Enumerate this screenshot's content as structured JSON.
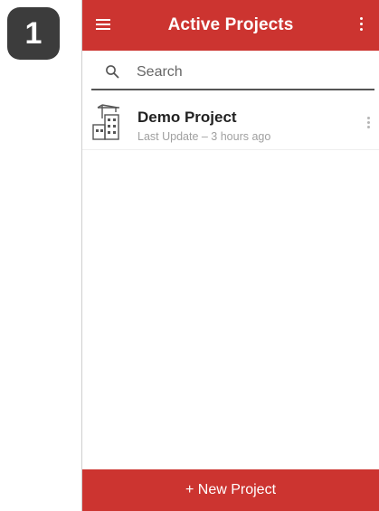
{
  "step": {
    "number": "1"
  },
  "appbar": {
    "title": "Active Projects",
    "menu_icon": "hamburger-menu-icon",
    "overflow_icon": "more-vertical-icon",
    "color": "#cc3430"
  },
  "search": {
    "placeholder": "Search",
    "value": "",
    "icon": "search-icon"
  },
  "projects": [
    {
      "name": "Demo Project",
      "subtitle": "Last Update – 3 hours ago",
      "icon": "building-crane-icon"
    }
  ],
  "footer": {
    "new_project_label": "+ New Project"
  }
}
